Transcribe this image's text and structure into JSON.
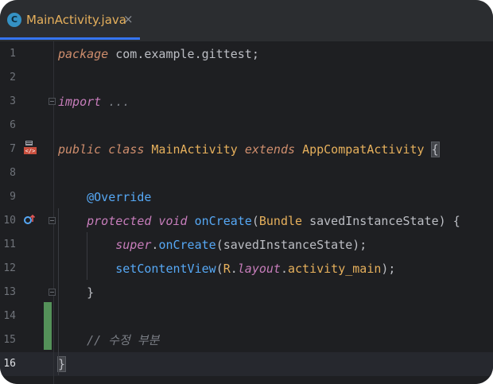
{
  "tab": {
    "icon_letter": "C",
    "title": "MainActivity.java",
    "close": "×"
  },
  "lines": [
    {
      "n": "1",
      "tokens": [
        {
          "t": "package",
          "c": "kwi"
        },
        {
          "t": " com.example.gittest;",
          "c": ""
        }
      ]
    },
    {
      "n": "2",
      "tokens": []
    },
    {
      "n": "3",
      "tokens": [
        {
          "t": "import",
          "c": "kwp"
        },
        {
          "t": " ...",
          "c": "cm"
        }
      ]
    },
    {
      "n": "6",
      "tokens": []
    },
    {
      "n": "7",
      "tokens": [
        {
          "t": "public class ",
          "c": "kwi"
        },
        {
          "t": "MainActivity ",
          "c": "cls"
        },
        {
          "t": "extends ",
          "c": "kwi"
        },
        {
          "t": "AppCompatActivity ",
          "c": "cls"
        },
        {
          "t": "{",
          "c": "brace"
        }
      ]
    },
    {
      "n": "8",
      "tokens": []
    },
    {
      "n": "9",
      "tokens": [
        {
          "t": "    ",
          "c": ""
        },
        {
          "t": "@Override",
          "c": "fn"
        }
      ]
    },
    {
      "n": "10",
      "tokens": [
        {
          "t": "    ",
          "c": ""
        },
        {
          "t": "protected void ",
          "c": "kwp"
        },
        {
          "t": "onCreate",
          "c": "fn"
        },
        {
          "t": "(",
          "c": ""
        },
        {
          "t": "Bundle ",
          "c": "cls"
        },
        {
          "t": "savedInstanceState) {",
          "c": ""
        }
      ]
    },
    {
      "n": "11",
      "tokens": [
        {
          "t": "        ",
          "c": ""
        },
        {
          "t": "super",
          "c": "kwp"
        },
        {
          "t": ".",
          "c": ""
        },
        {
          "t": "onCreate",
          "c": "fn"
        },
        {
          "t": "(savedInstanceState);",
          "c": ""
        }
      ]
    },
    {
      "n": "12",
      "tokens": [
        {
          "t": "        ",
          "c": ""
        },
        {
          "t": "setContentView",
          "c": "fn"
        },
        {
          "t": "(",
          "c": ""
        },
        {
          "t": "R",
          "c": "cls"
        },
        {
          "t": ".",
          "c": ""
        },
        {
          "t": "layout",
          "c": "field"
        },
        {
          "t": ".",
          "c": ""
        },
        {
          "t": "activity_main",
          "c": "cls"
        },
        {
          "t": ");",
          "c": ""
        }
      ]
    },
    {
      "n": "13",
      "tokens": [
        {
          "t": "    }",
          "c": ""
        }
      ]
    },
    {
      "n": "14",
      "tokens": []
    },
    {
      "n": "15",
      "tokens": [
        {
          "t": "    ",
          "c": ""
        },
        {
          "t": "// 수정 부분",
          "c": "cm"
        }
      ]
    },
    {
      "n": "16",
      "tokens": [
        {
          "t": "}",
          "c": "brace"
        }
      ]
    }
  ],
  "current_line": "16",
  "colors": {
    "background": "#1e1f22",
    "keyword": "#cf8e6d",
    "function": "#56a8f5",
    "class": "#e6b05c",
    "comment": "#7a7e85",
    "vcs_added": "#549159"
  }
}
